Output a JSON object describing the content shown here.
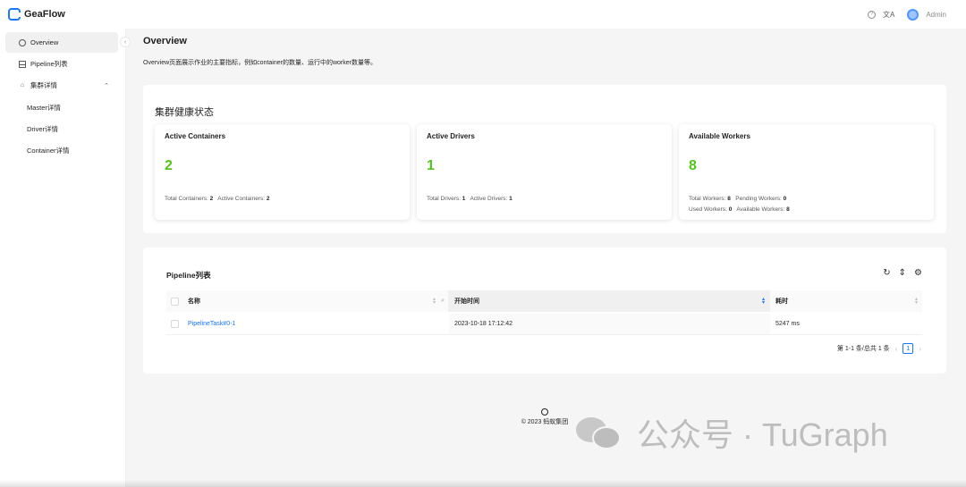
{
  "app": {
    "name": "GeaFlow"
  },
  "header": {
    "help_icon": "question-circle-icon",
    "translate_icon": "translate-icon",
    "translate_glyph": "文A",
    "user": "Admin"
  },
  "sidebar": {
    "items": [
      {
        "label": "Overview",
        "icon": "dashboard-icon",
        "active": true
      },
      {
        "label": "Pipeline列表",
        "icon": "table-icon"
      },
      {
        "label": "集群详情",
        "icon": "cluster-icon",
        "expanded": true
      }
    ],
    "sub_items": [
      {
        "label": "Master详情"
      },
      {
        "label": "Driver详情"
      },
      {
        "label": "Container详情"
      }
    ]
  },
  "page": {
    "title": "Overview",
    "description": "Overview页面展示作业的主要指标，例如container的数量、运行中的worker数量等。"
  },
  "health": {
    "title": "集群健康状态",
    "cards": [
      {
        "title": "Active Containers",
        "value": "2",
        "stats": [
          [
            {
              "label": "Total Containers:",
              "value": "2"
            },
            {
              "label": "Active Containers:",
              "value": "2"
            }
          ]
        ]
      },
      {
        "title": "Active Drivers",
        "value": "1",
        "stats": [
          [
            {
              "label": "Total Drivers:",
              "value": "1"
            },
            {
              "label": "Active Drivers:",
              "value": "1"
            }
          ]
        ]
      },
      {
        "title": "Available Workers",
        "value": "8",
        "stats": [
          [
            {
              "label": "Total Workers:",
              "value": "8"
            },
            {
              "label": "Pending Workers:",
              "value": "0"
            }
          ],
          [
            {
              "label": "Used Workers:",
              "value": "0"
            },
            {
              "label": "Available Workers:",
              "value": "8"
            }
          ]
        ]
      }
    ],
    "accent_color": "#52c41a"
  },
  "pipeline_table": {
    "title": "Pipeline列表",
    "tools": [
      "reload-icon",
      "column-height-icon",
      "setting-icon"
    ],
    "columns": [
      {
        "label": "名称",
        "sortable": true,
        "filterable": true
      },
      {
        "label": "开始时间",
        "sortable": true,
        "sorted": "desc"
      },
      {
        "label": "耗时",
        "sortable": true
      }
    ],
    "rows": [
      {
        "name": "PipelineTask#0-1",
        "start_time": "2023-10-18 17:12:42",
        "duration": "5247 ms"
      }
    ],
    "pagination": {
      "summary": "第 1-1 条/总共 1 条",
      "current_page": "1"
    }
  },
  "footer": {
    "copyright": "© 2023 蚂蚁集团",
    "icon": "github-icon"
  },
  "watermark": {
    "text": "公众号 · TuGraph",
    "icon": "wechat-icon"
  },
  "colors": {
    "primary": "#1677ff",
    "success": "#52c41a"
  }
}
